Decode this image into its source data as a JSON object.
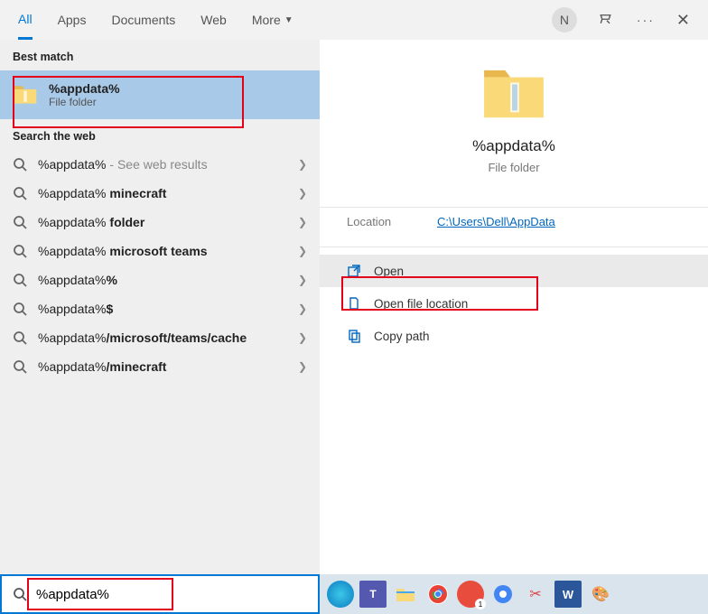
{
  "header": {
    "tabs": [
      "All",
      "Apps",
      "Documents",
      "Web",
      "More"
    ],
    "avatar_initial": "N"
  },
  "left": {
    "best_match_label": "Best match",
    "best_match": {
      "title": "%appdata%",
      "subtitle": "File folder"
    },
    "search_web_label": "Search the web",
    "web_items": [
      {
        "prefix": "%appdata%",
        "bold": "",
        "suffix": " - See web results"
      },
      {
        "prefix": "%appdata%",
        "bold": " minecraft",
        "suffix": ""
      },
      {
        "prefix": "%appdata%",
        "bold": " folder",
        "suffix": ""
      },
      {
        "prefix": "%appdata%",
        "bold": " microsoft teams",
        "suffix": ""
      },
      {
        "prefix": "%appdata%",
        "bold": "%",
        "suffix": ""
      },
      {
        "prefix": "%appdata%",
        "bold": "$",
        "suffix": ""
      },
      {
        "prefix": "%appdata%",
        "bold": "/microsoft/teams/cache",
        "suffix": ""
      },
      {
        "prefix": "%appdata%",
        "bold": "/minecraft",
        "suffix": ""
      }
    ]
  },
  "right": {
    "title": "%appdata%",
    "subtitle": "File folder",
    "location_label": "Location",
    "location_value": "C:\\Users\\Dell\\AppData",
    "actions": {
      "open": "Open",
      "open_loc": "Open file location",
      "copy": "Copy path"
    }
  },
  "search": {
    "value": "%appdata%"
  },
  "taskbar": {
    "icons": [
      "edge",
      "teams",
      "explorer",
      "chrome",
      "brave",
      "chrome2",
      "snip",
      "word",
      "paint"
    ]
  }
}
